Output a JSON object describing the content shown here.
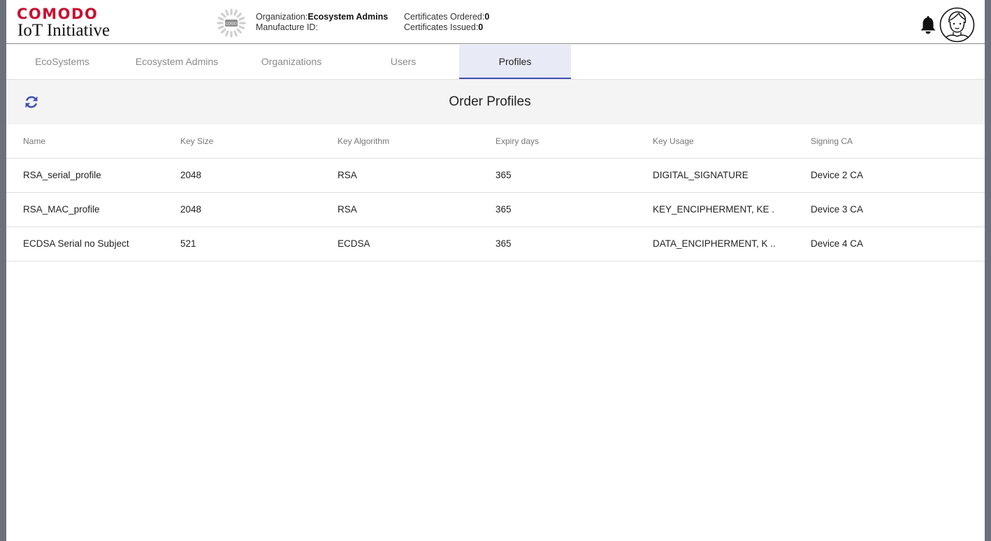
{
  "brand": {
    "top": "COMODO",
    "bottom": "IoT Initiative"
  },
  "org_info": {
    "org_label": "Organization:",
    "org_value": "Ecosystem Admins",
    "manufacture_label": "Manufacture ID:",
    "manufacture_value": ""
  },
  "cert_info": {
    "ordered_label": "Certificates Ordered:",
    "ordered_value": "0",
    "issued_label": "Certificates Issued:",
    "issued_value": "0"
  },
  "logo_placeholder": "LOGO",
  "tabs": [
    {
      "label": "EcoSystems",
      "active": false
    },
    {
      "label": "Ecosystem Admins",
      "active": false
    },
    {
      "label": "Organizations",
      "active": false
    },
    {
      "label": "Users",
      "active": false
    },
    {
      "label": "Profiles",
      "active": true
    }
  ],
  "panel": {
    "title": "Order Profiles"
  },
  "table": {
    "columns": [
      "Name",
      "Key Size",
      "Key Algorithm",
      "Expiry days",
      "Key Usage",
      "Signing CA"
    ],
    "rows": [
      [
        "RSA_serial_profile",
        "2048",
        "RSA",
        "365",
        "DIGITAL_SIGNATURE",
        "Device 2 CA"
      ],
      [
        "RSA_MAC_profile",
        "2048",
        "RSA",
        "365",
        "KEY_ENCIPHERMENT, KE ...",
        "Device 3 CA"
      ],
      [
        "ECDSA Serial no Subject",
        "521",
        "ECDSA",
        "365",
        "DATA_ENCIPHERMENT, K ...",
        "Device 4 CA"
      ]
    ]
  },
  "colors": {
    "brand_red": "#c8102e",
    "accent": "#3f51b5",
    "active_tab_bg": "#e8eaf6"
  },
  "icons": {
    "notifications": "bell-icon",
    "user": "avatar-icon",
    "refresh": "refresh-icon"
  }
}
